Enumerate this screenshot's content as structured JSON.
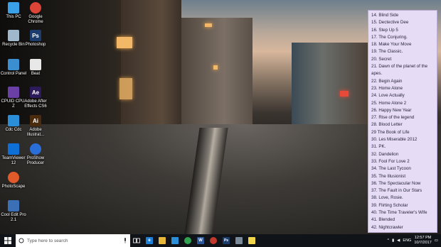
{
  "desktop": {
    "icons": [
      {
        "label": "This PC",
        "icon": "computer-icon",
        "color": "#3aa0e8"
      },
      {
        "label": "Google Chrome",
        "icon": "chrome-icon",
        "color": "#db4437"
      },
      {
        "label": "Recycle Bin",
        "icon": "recycle-bin-icon",
        "color": "#9fb8cc"
      },
      {
        "label": "Photoshop",
        "icon": "photoshop-icon",
        "color": "#1c3d6b"
      },
      {
        "label": "Control Panel",
        "icon": "control-panel-icon",
        "color": "#3b8fd1"
      },
      {
        "label": "Beat",
        "icon": "document-icon",
        "color": "#e8e8e8"
      },
      {
        "label": "CPUID CPU-Z",
        "icon": "cpuz-icon",
        "color": "#6a3fa6"
      },
      {
        "label": "Adobe After Effects CS6",
        "icon": "after-effects-icon",
        "color": "#2d1a5a"
      },
      {
        "label": "Cdc Cdc",
        "icon": "windows-icon",
        "color": "#2a8fd8"
      },
      {
        "label": "Adobe Illustrat...",
        "icon": "illustrator-icon",
        "color": "#4a2b0e"
      },
      {
        "label": "TeamViewer 12",
        "icon": "teamviewer-icon",
        "color": "#0e6fd6"
      },
      {
        "label": "ProShow Producer",
        "icon": "proshow-icon",
        "color": "#2a6ed8"
      },
      {
        "label": "PhotoScape",
        "icon": "photoscape-icon",
        "color": "#e05a2a"
      },
      {
        "label": "Cool Edit Pro 2.1",
        "icon": "cool-edit-icon",
        "color": "#3b6fb6"
      }
    ]
  },
  "movie_list": [
    "14. Blind Side",
    "15. Dectective Dee",
    "16. Step Up 5",
    "17. The Conjuring.",
    "18. Make Your Move",
    "19. The Classic.",
    "20. Secret",
    "21. Dawn of the planet of the apes.",
    "22. Begin Again",
    "23. Home Alone",
    "24. Love Actually",
    "25. Home Alone 2",
    "26. Happy New Year",
    "27. Rise of the legend",
    "28. Blood Letter",
    "29 The Book of Life",
    "30. Les Miserable 2012",
    "31. PK.",
    "32. Dandelion",
    "33. Fool For Love 2",
    "34. The Last Tycoon",
    "35. The Illusionist",
    "36. The Spectacular Now",
    "37. The Fault in Our Stars",
    "38. Love, Rosie.",
    "39. Flirting Scholar",
    "40. The Time Traveler's Wife",
    "41. Blended",
    "42. Nightcrawler"
  ],
  "taskbar": {
    "search_placeholder": "Type here to search",
    "apps": [
      {
        "name": "edge-icon",
        "color": "#1e7fd6",
        "glyph": "e"
      },
      {
        "name": "file-explorer-icon",
        "color": "#e7b73a",
        "glyph": ""
      },
      {
        "name": "store-icon",
        "color": "#2a8fd8",
        "glyph": ""
      },
      {
        "name": "chrome-icon",
        "color": "#2fa24f",
        "glyph": ""
      },
      {
        "name": "word-icon",
        "color": "#2b579a",
        "glyph": "W"
      },
      {
        "name": "media-player-icon",
        "color": "#c0392b",
        "glyph": ""
      },
      {
        "name": "photoshop-icon",
        "color": "#1c3d6b",
        "glyph": "Ps"
      },
      {
        "name": "photos-icon",
        "color": "#7a8a99",
        "glyph": ""
      },
      {
        "name": "notes-icon",
        "color": "#f1d64a",
        "glyph": ""
      }
    ],
    "language": "ENG",
    "time": "12:57 PM",
    "date": "10/7/2017"
  }
}
